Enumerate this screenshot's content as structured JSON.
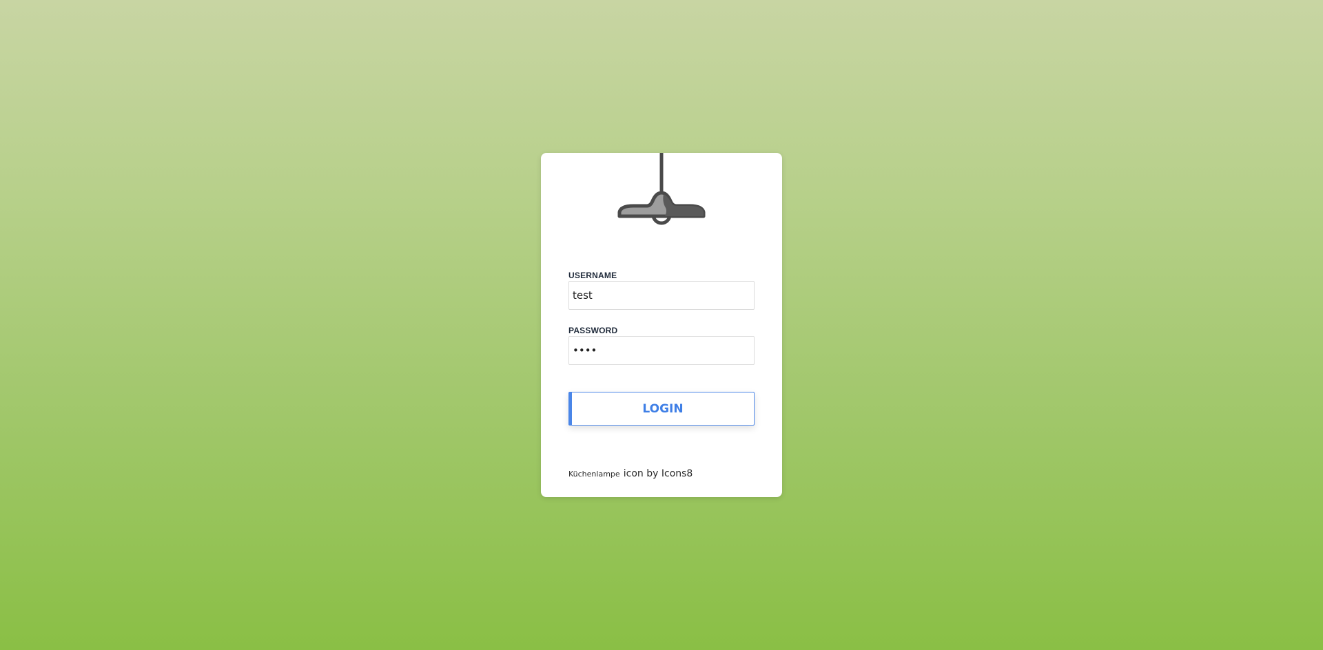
{
  "login": {
    "username_label": "USERNAME",
    "username_value": "test",
    "password_label": "PASSWORD",
    "password_value": "••••",
    "button_label": "LOGIN"
  },
  "credit": {
    "icon_name": "Küchenlampe",
    "text": "icon by Icons8"
  },
  "icons": {
    "logo": "kitchen-lamp-icon"
  },
  "colors": {
    "accent": "#4a86e8",
    "background_top": "#c8d5a3",
    "background_bottom": "#8abf45"
  }
}
